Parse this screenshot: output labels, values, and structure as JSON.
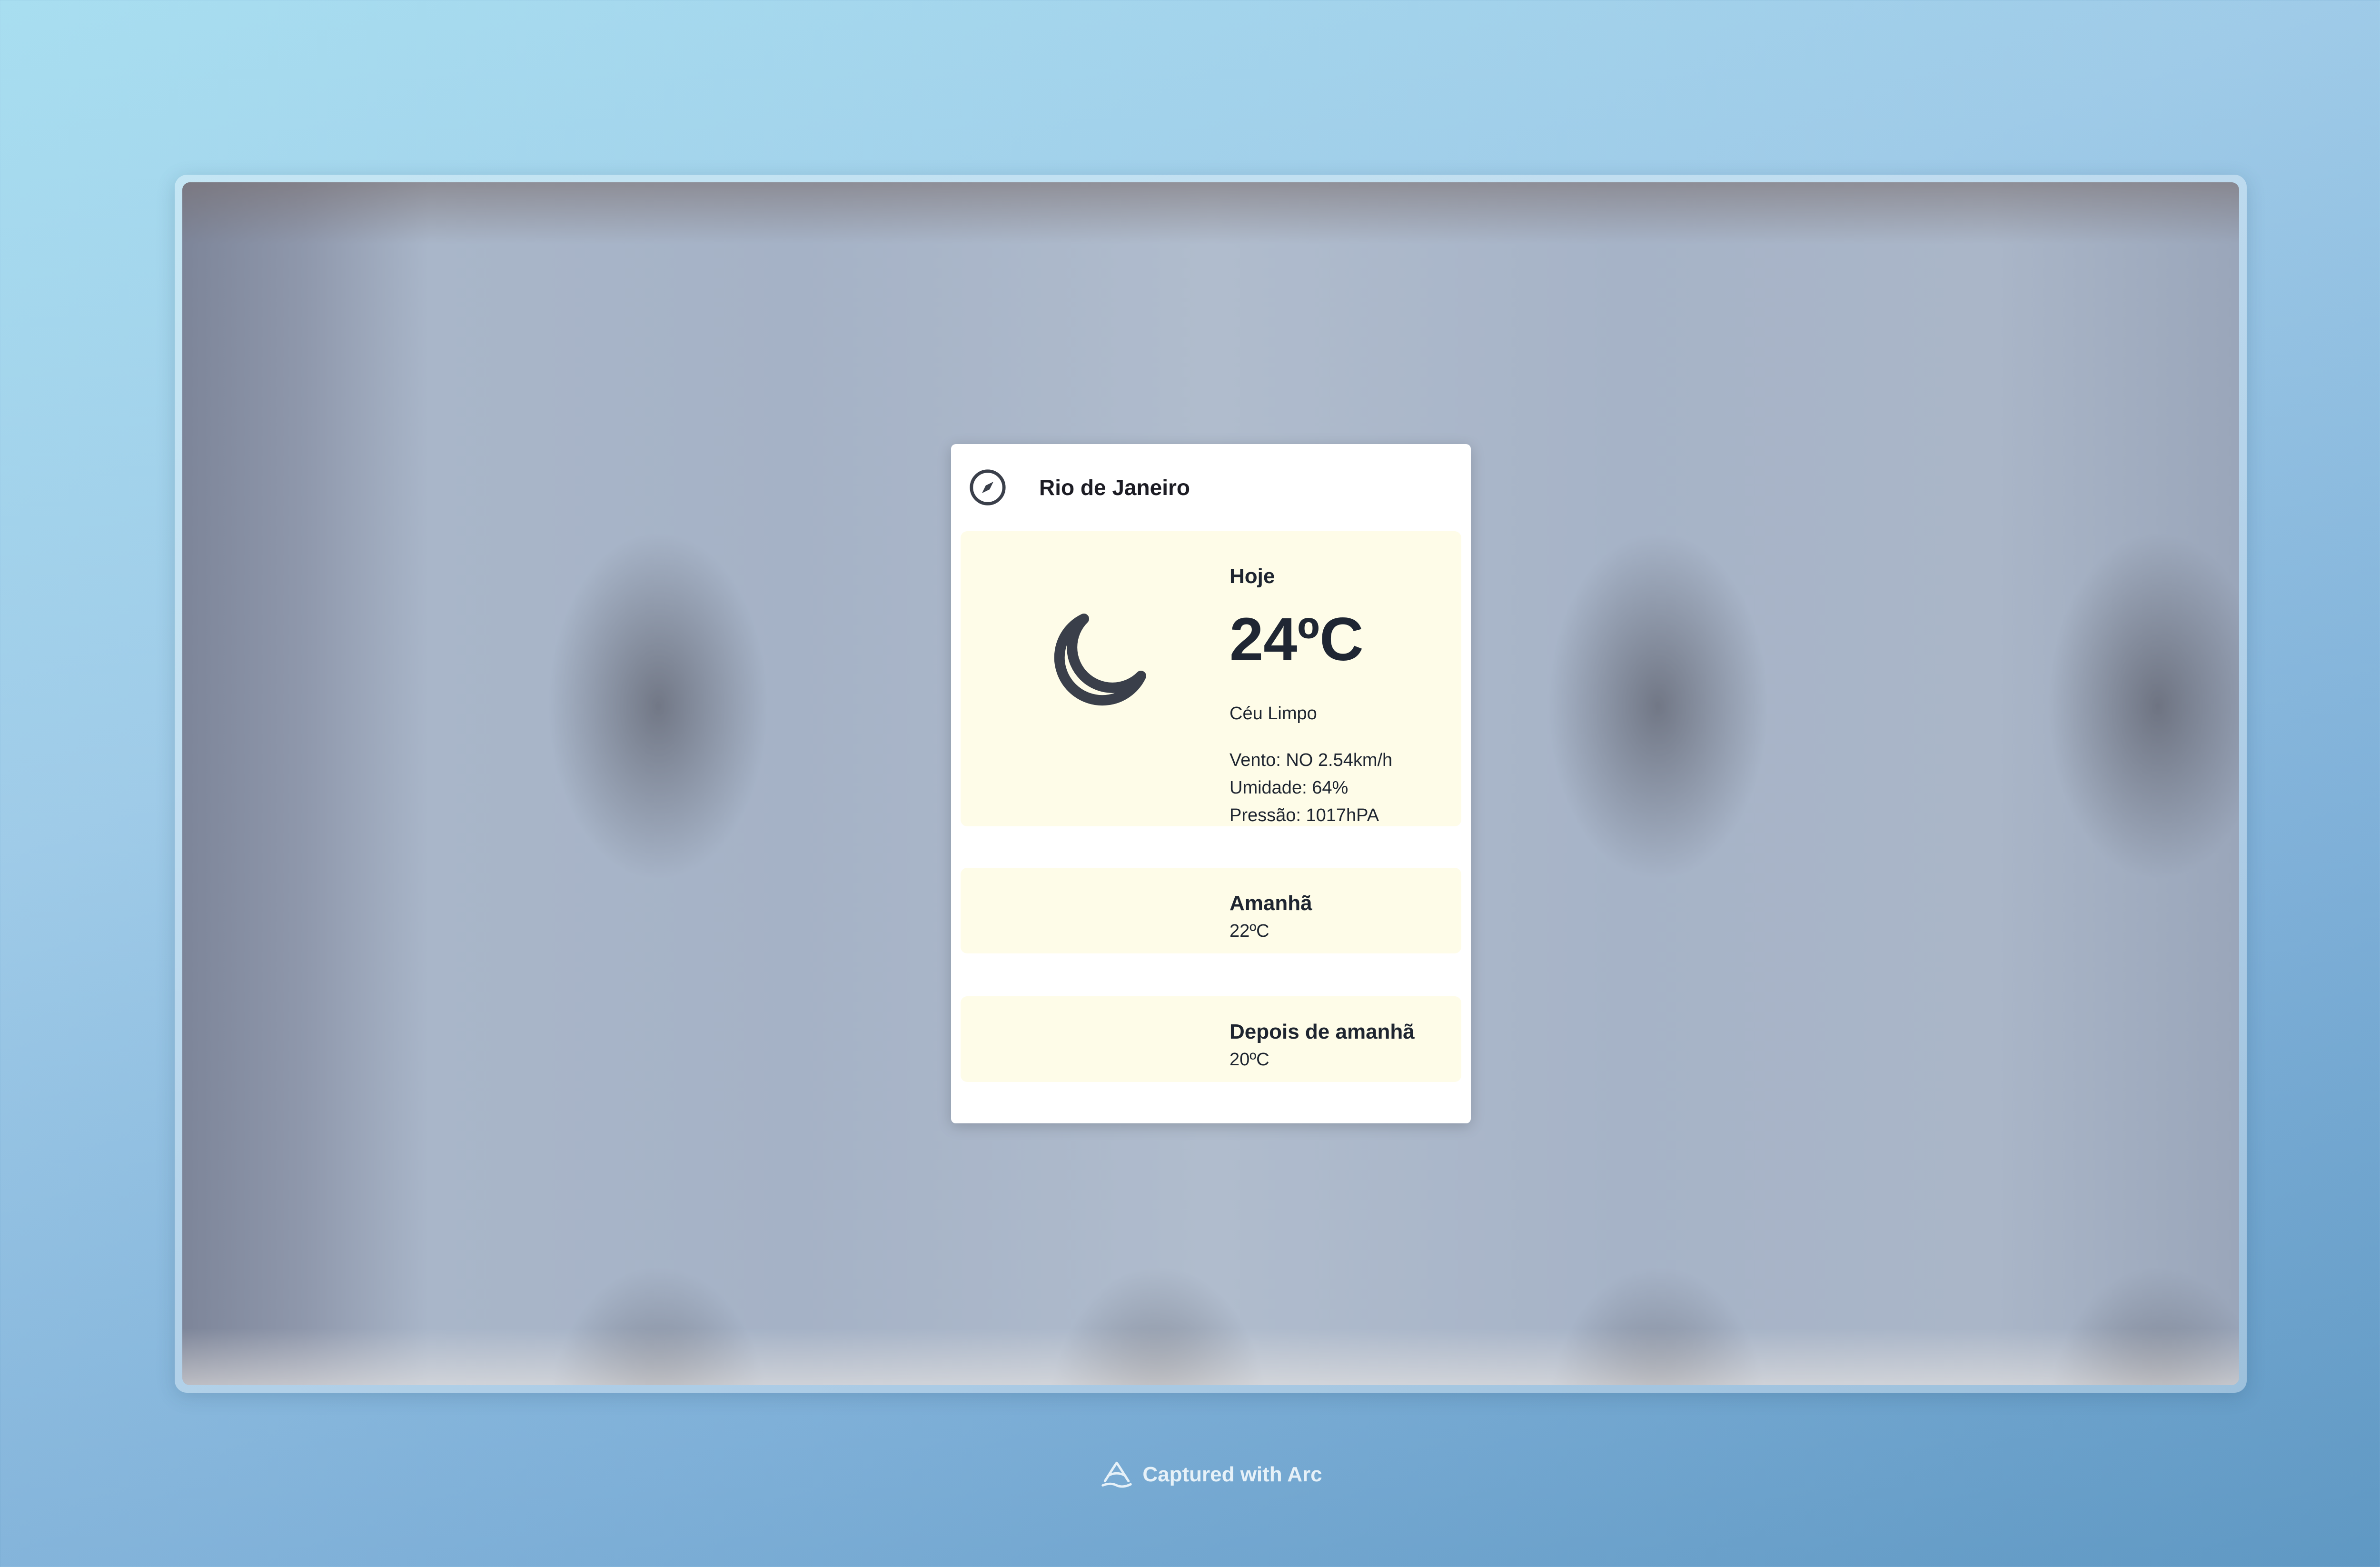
{
  "card": {
    "city": "Rio de Janeiro",
    "icons": {
      "location": "compass-icon",
      "current_weather": "moon-icon"
    },
    "today": {
      "label": "Hoje",
      "temperature": "24ºC",
      "condition": "Céu Limpo",
      "wind": "Vento: NO 2.54km/h",
      "humidity": "Umidade: 64%",
      "pressure": "Pressão: 1017hPA"
    },
    "tomorrow": {
      "label": "Amanhã",
      "temperature": "22ºC"
    },
    "after_tomorrow": {
      "label": "Depois de amanhã",
      "temperature": "20ºC"
    }
  },
  "colors": {
    "panel_today": "#fefce8",
    "panel_tomorrow": "#fefce8",
    "panel_after_tomorrow": "#fefce8",
    "text": "#1e2530"
  },
  "footer": {
    "capture_label": "Captured with Arc"
  }
}
